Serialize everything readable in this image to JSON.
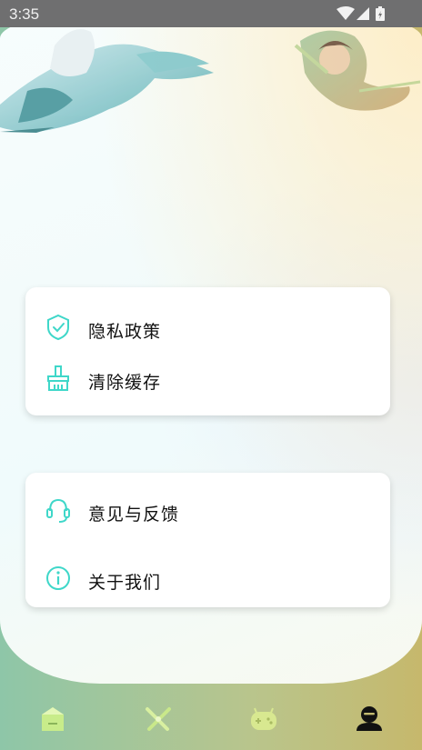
{
  "status_bar": {
    "time": "3:35"
  },
  "menu": {
    "group1": [
      {
        "label": "隐私政策",
        "icon": "shield-check-icon"
      },
      {
        "label": "清除缓存",
        "icon": "broom-icon"
      }
    ],
    "group2": [
      {
        "label": "意见与反馈",
        "icon": "headset-icon"
      },
      {
        "label": "关于我们",
        "icon": "info-icon"
      }
    ]
  },
  "tabs": [
    {
      "icon": "home-icon",
      "active": false
    },
    {
      "icon": "crossed-swords-icon",
      "active": false
    },
    {
      "icon": "gamepad-icon",
      "active": false
    },
    {
      "icon": "profile-icon",
      "active": true
    }
  ],
  "colors": {
    "accent": "#3fd7c9",
    "active_tab": "#111111"
  }
}
